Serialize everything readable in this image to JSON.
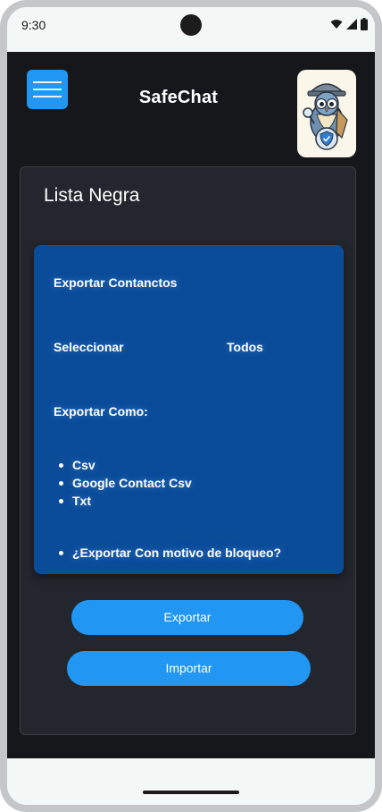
{
  "status_bar": {
    "time": "9:30"
  },
  "header": {
    "title": "SafeChat"
  },
  "card": {
    "title": "Lista Negra",
    "export_panel": {
      "heading": "Exportar Contanctos",
      "select_label": "Seleccionar",
      "all_label": "Todos",
      "format_label": "Exportar Como:",
      "formats": [
        "Csv",
        "Google Contact Csv",
        "Txt"
      ],
      "reason_option": "¿Exportar Con motivo de bloqueo?"
    },
    "buttons": {
      "export": "Exportar",
      "import": "Importar"
    }
  },
  "colors": {
    "accent": "#2196f3",
    "panel": "#0b4c99",
    "card": "#24262d",
    "background": "#16171b"
  },
  "icons": [
    "menu-icon",
    "wifi-icon",
    "signal-icon",
    "battery-icon",
    "owl-detective-logo",
    "shield-check-icon"
  ]
}
